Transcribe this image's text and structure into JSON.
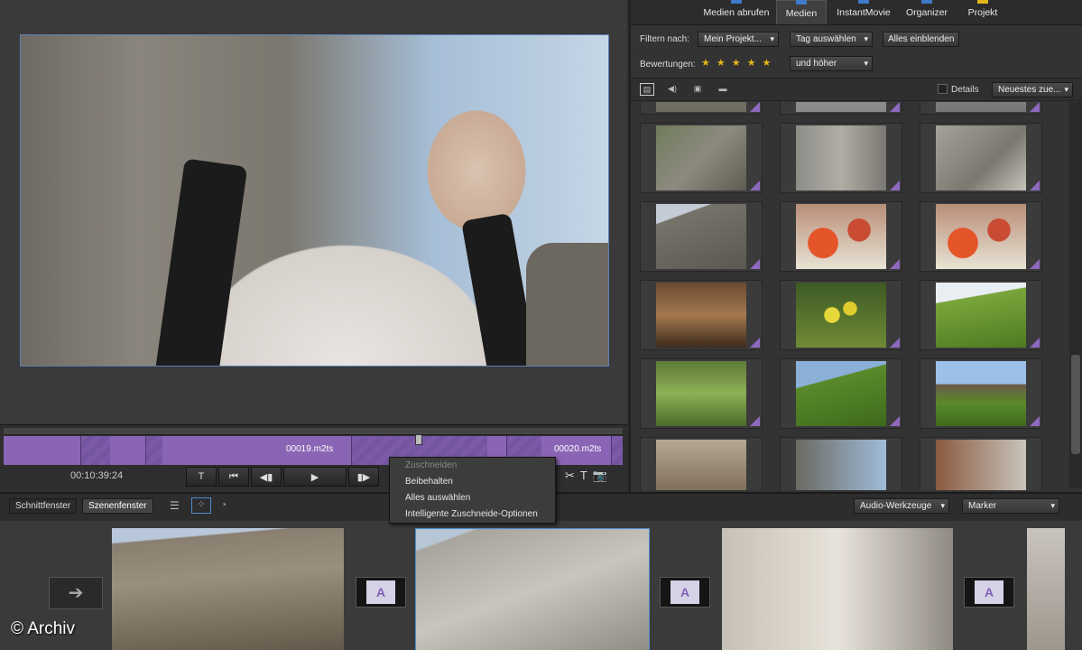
{
  "topnav": {
    "tabs": [
      {
        "label": "Medien abrufen",
        "icon": "download-icon",
        "active": false
      },
      {
        "label": "Medien",
        "icon": "media-icon",
        "active": true
      },
      {
        "label": "InstantMovie",
        "icon": "movie-icon",
        "active": false
      },
      {
        "label": "Organizer",
        "icon": "organizer-icon",
        "active": false
      },
      {
        "label": "Projekt",
        "icon": "folder-icon",
        "active": false
      }
    ]
  },
  "filter": {
    "label": "Filtern nach:",
    "project_dd": "Mein Projekt...",
    "tag_dd": "Tag auswählen",
    "show_all": "Alles einblenden",
    "rating_label": "Bewertungen:",
    "stars": "★★★★★",
    "rating_dd": "und höher"
  },
  "viewbar": {
    "details_label": "Details",
    "sort_dd": "Neuestes zue..."
  },
  "scrubber": {
    "timecode": "00:10:39:24",
    "clip1": "00019.m2ts",
    "clip2": "00020.m2ts",
    "buttons": [
      "T",
      "⏮",
      "◀▮",
      "▶",
      "▮▶"
    ],
    "tools": [
      "✂",
      "T",
      "📷"
    ]
  },
  "context_menu": {
    "title": "Zuschneiden",
    "items": [
      "Beibehalten",
      "Alles auswählen",
      "Intelligente Zuschneide-Optionen"
    ]
  },
  "bottom": {
    "tabs": [
      "Schnittfenster",
      "Szenenfenster"
    ],
    "audio_dd": "Audio-Werkzeuge",
    "marker_dd": "Marker",
    "arrow": "➔",
    "transition_letter": "A"
  },
  "copyright": "© Archiv",
  "colors": {
    "accent": "#3f7ac9",
    "clip_purple": "#8b65b5",
    "star": "#e0b61b"
  }
}
